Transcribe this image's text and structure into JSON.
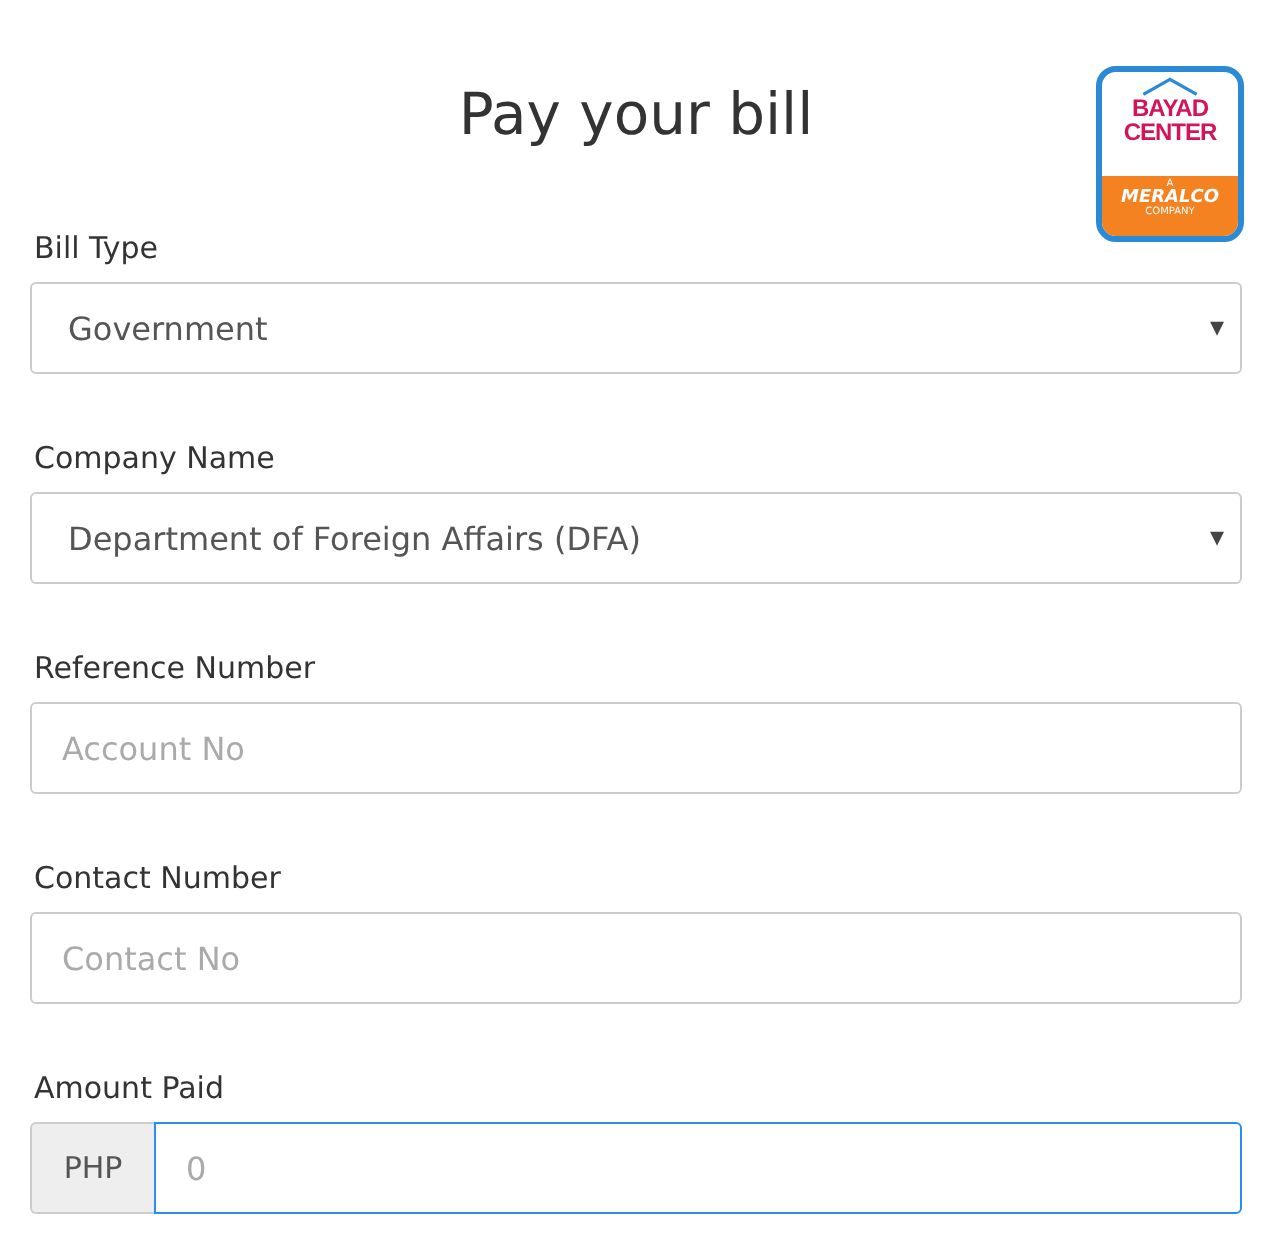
{
  "title": "Pay your bill",
  "logo": {
    "line_1": "BAYAD",
    "line_2": "CENTER",
    "line_3": "A",
    "line_4": "MERALCO",
    "line_5": "COMPANY"
  },
  "fields": [
    {
      "kind": "select",
      "label": "Bill Type",
      "value": "Government",
      "arrow": "▾"
    },
    {
      "kind": "select",
      "label": "Company Name",
      "value": "Department of Foreign Affairs (DFA)",
      "arrow": "▾"
    },
    {
      "kind": "text",
      "label": "Reference Number",
      "placeholder": "Account No"
    },
    {
      "kind": "text",
      "label": "Contact Number",
      "placeholder": "Contact No"
    },
    {
      "kind": "addon",
      "label": "Amount Paid",
      "addon": "PHP",
      "placeholder": "0",
      "focused": true
    }
  ]
}
